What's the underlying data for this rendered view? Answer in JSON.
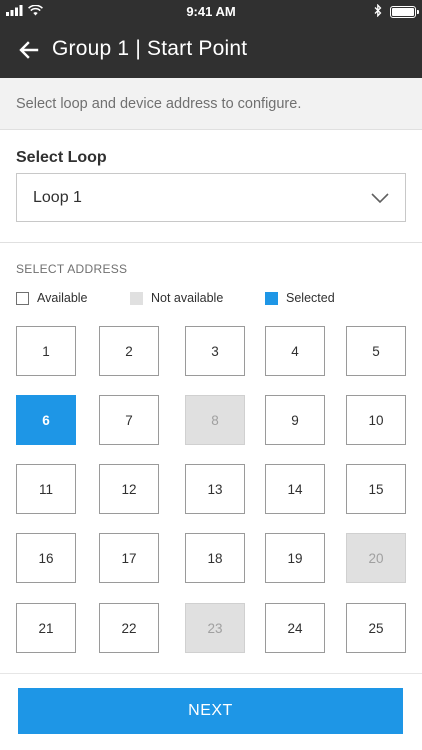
{
  "status_bar": {
    "time": "9:41 AM"
  },
  "header": {
    "title": "Group 1 | Start Point"
  },
  "instruction": "Select loop and device address to configure.",
  "loop": {
    "label": "Select Loop",
    "value": "Loop 1"
  },
  "address_section": {
    "heading": "SELECT ADDRESS",
    "legend": {
      "available": "Available",
      "not_available": "Not available",
      "selected": "Selected"
    }
  },
  "addresses": [
    {
      "label": "1",
      "state": "available"
    },
    {
      "label": "2",
      "state": "available"
    },
    {
      "label": "3",
      "state": "available"
    },
    {
      "label": "4",
      "state": "available"
    },
    {
      "label": "5",
      "state": "available"
    },
    {
      "label": "6",
      "state": "selected"
    },
    {
      "label": "7",
      "state": "available"
    },
    {
      "label": "8",
      "state": "unavailable"
    },
    {
      "label": "9",
      "state": "available"
    },
    {
      "label": "10",
      "state": "available"
    },
    {
      "label": "11",
      "state": "available"
    },
    {
      "label": "12",
      "state": "available"
    },
    {
      "label": "13",
      "state": "available"
    },
    {
      "label": "14",
      "state": "available"
    },
    {
      "label": "15",
      "state": "available"
    },
    {
      "label": "16",
      "state": "available"
    },
    {
      "label": "17",
      "state": "available"
    },
    {
      "label": "18",
      "state": "available"
    },
    {
      "label": "19",
      "state": "available"
    },
    {
      "label": "20",
      "state": "unavailable"
    },
    {
      "label": "21",
      "state": "available"
    },
    {
      "label": "22",
      "state": "available"
    },
    {
      "label": "23",
      "state": "unavailable"
    },
    {
      "label": "24",
      "state": "available"
    },
    {
      "label": "25",
      "state": "available"
    }
  ],
  "next_label": "NEXT",
  "colors": {
    "header": "#303030",
    "accent": "#1e96e6",
    "unavailable": "#e0e0e0"
  }
}
